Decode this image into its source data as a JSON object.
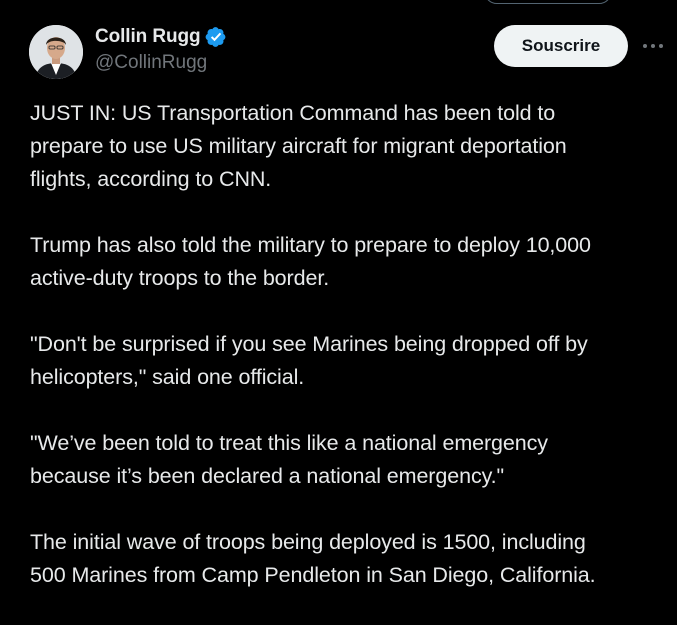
{
  "author": {
    "display_name": "Collin Rugg",
    "handle": "@CollinRugg",
    "verified": true,
    "verified_color": "#1d9bf0"
  },
  "actions": {
    "subscribe_label": "Souscrire",
    "more_icon": "more-horizontal-icon"
  },
  "tweet": {
    "paragraphs": [
      "JUST IN: US Transportation Command has been told to\nprepare to use US military aircraft for migrant deportation\nflights, according to CNN.",
      "Trump has also told the military to prepare to deploy 10,000\nactive-duty troops to the border.",
      "\"Don't be surprised if you see Marines being dropped off by\nhelicopters,\" said one official.",
      "\"We’ve been told to treat this like a national emergency\nbecause it’s been declared a national emergency.\"",
      "The initial wave of troops being deployed is 1500, including\n500 Marines from Camp Pendleton in San Diego, California."
    ]
  },
  "colors": {
    "background": "#000000",
    "text_primary": "#e7e9ea",
    "text_secondary": "#71767b",
    "button_bg": "#eff3f4",
    "button_text": "#0f1419"
  }
}
